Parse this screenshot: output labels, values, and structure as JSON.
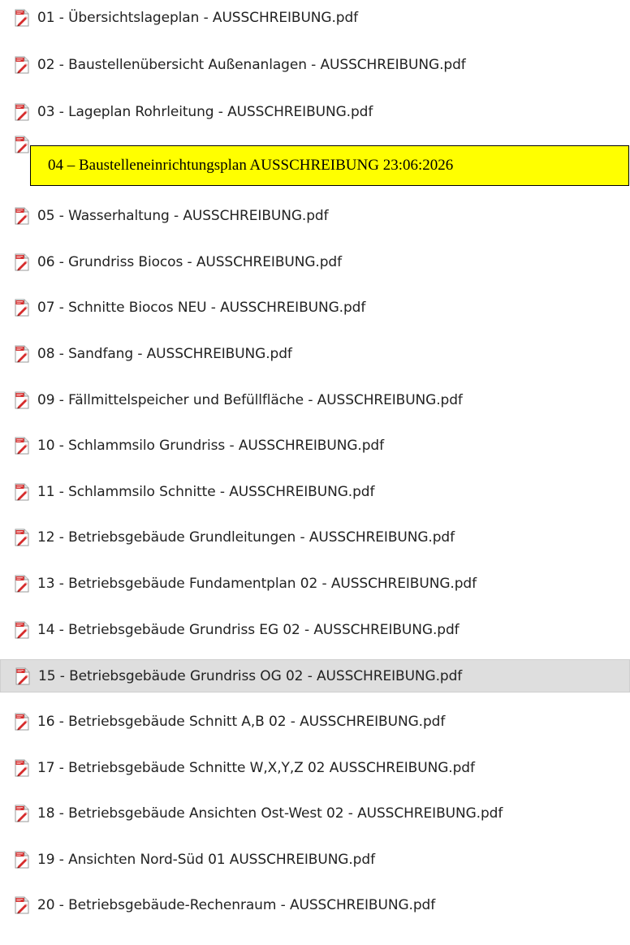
{
  "file_list": {
    "icon": "pdf-file-icon",
    "colors": {
      "selection_background": "#dedede",
      "highlight_background": "#ffff00",
      "highlight_border": "#000000"
    },
    "items": [
      {
        "label": "01 - Übersichtslageplan - AUSSCHREIBUNG.pdf"
      },
      {
        "label": "02 - Baustellenübersicht  Außenanlagen - AUSSCHREIBUNG.pdf"
      },
      {
        "label": "03 - Lageplan Rohrleitung - AUSSCHREIBUNG.pdf"
      },
      {
        "label": "04 – Baustelleneinrichtungsplan AUSSCHREIBUNG 23:06:2026",
        "highlighted": true
      },
      {
        "label": "05 - Wasserhaltung - AUSSCHREIBUNG.pdf"
      },
      {
        "label": "06 - Grundriss Biocos - AUSSCHREIBUNG.pdf"
      },
      {
        "label": "07 - Schnitte Biocos NEU - AUSSCHREIBUNG.pdf"
      },
      {
        "label": "08 - Sandfang - AUSSCHREIBUNG.pdf"
      },
      {
        "label": "09 - Fällmittelspeicher und Befüllfläche - AUSSCHREIBUNG.pdf"
      },
      {
        "label": "10 - Schlammsilo Grundriss - AUSSCHREIBUNG.pdf"
      },
      {
        "label": "11 - Schlammsilo Schnitte - AUSSCHREIBUNG.pdf"
      },
      {
        "label": "12 - Betriebsgebäude Grundleitungen - AUSSCHREIBUNG.pdf"
      },
      {
        "label": "13 - Betriebsgebäude Fundamentplan 02 - AUSSCHREIBUNG.pdf"
      },
      {
        "label": "14 - Betriebsgebäude Grundriss EG 02 - AUSSCHREIBUNG.pdf"
      },
      {
        "label": "15 - Betriebsgebäude Grundriss OG 02 - AUSSCHREIBUNG.pdf",
        "selected": true
      },
      {
        "label": "16 - Betriebsgebäude Schnitt A,B 02 - AUSSCHREIBUNG.pdf"
      },
      {
        "label": "17 - Betriebsgebäude Schnitte W,X,Y,Z 02 AUSSCHREIBUNG.pdf"
      },
      {
        "label": "18 - Betriebsgebäude Ansichten Ost-West 02 - AUSSCHREIBUNG.pdf"
      },
      {
        "label": "19 - Ansichten Nord-Süd 01 AUSSCHREIBUNG.pdf"
      },
      {
        "label": "20 - Betriebsgebäude-Rechenraum - AUSSCHREIBUNG.pdf"
      }
    ]
  }
}
